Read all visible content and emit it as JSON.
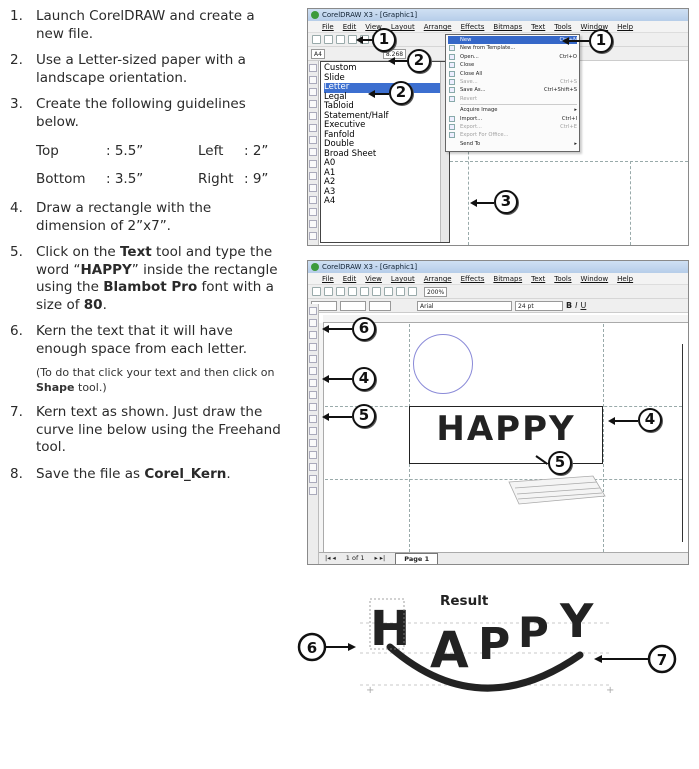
{
  "steps": [
    {
      "num": "1.",
      "text": "Launch CorelDRAW and create a new file."
    },
    {
      "num": "2.",
      "text": "Use a Letter-sized paper with a landscape orientation."
    },
    {
      "num": "3.",
      "text": "Create the following guidelines below."
    },
    {
      "num": "4.",
      "text": "Draw a rectangle with the dimension of 2”x7”."
    },
    {
      "num": "5.",
      "pre": "Click on the ",
      "b1": "Text",
      "mid1": " tool and type the word “",
      "b2": "HAPPY",
      "mid2": "” inside the rectangle using the ",
      "b3": "Blambot Pro",
      "mid3": " font with a size of ",
      "b4": "80",
      "post": "."
    },
    {
      "num": "6.",
      "text": "Kern the text that it will have enough space from each letter."
    },
    {
      "num": "7.",
      "text": "Kern text as shown. Just draw the curve line below using the Freehand tool."
    },
    {
      "num": "8.",
      "pre": "Save the file as ",
      "b1": "Corel_Kern",
      "post": "."
    }
  ],
  "note": {
    "pre": "(To do that click your text and then click on ",
    "bold": "Shape",
    "post": " tool.)"
  },
  "guidelines": [
    {
      "a": "Top",
      "av": ": 5.5”",
      "b": "Left",
      "bv": ": 2”"
    },
    {
      "a": "Bottom",
      "av": ": 3.5”",
      "b": "Right",
      "bv": ": 9”"
    }
  ],
  "shot1": {
    "title": "CorelDRAW X3 - [Graphic1]",
    "menus": [
      "File",
      "Edit",
      "View",
      "Layout",
      "Arrange",
      "Effects",
      "Bitmaps",
      "Text",
      "Tools",
      "Window",
      "Help"
    ],
    "paper_field": "A4",
    "size_field": "8.268",
    "paper_options": [
      "Custom",
      "Slide",
      "Letter",
      "Legal",
      "Tabloid",
      "Statement/Half",
      "Executive",
      "Fanfold",
      "Double",
      "Broad Sheet",
      "A0",
      "A1",
      "A2",
      "A3",
      "A4"
    ],
    "paper_selected": "Letter",
    "file_menu": [
      {
        "label": "New",
        "shortcut": "Ctrl+N",
        "state": "hl"
      },
      {
        "label": "New from Template...",
        "shortcut": "",
        "state": ""
      },
      {
        "label": "Open...",
        "shortcut": "Ctrl+O",
        "state": ""
      },
      {
        "label": "Close",
        "shortcut": "",
        "state": ""
      },
      {
        "label": "Close All",
        "shortcut": "",
        "state": ""
      },
      {
        "label": "Save...",
        "shortcut": "Ctrl+S",
        "state": "dim"
      },
      {
        "label": "Save As...",
        "shortcut": "Ctrl+Shift+S",
        "state": ""
      },
      {
        "label": "Revert",
        "shortcut": "",
        "state": "dim"
      },
      {
        "label": "Acquire Image",
        "shortcut": "",
        "state": ""
      },
      {
        "label": "Import...",
        "shortcut": "Ctrl+I",
        "state": ""
      },
      {
        "label": "Export...",
        "shortcut": "Ctrl+E",
        "state": "dim"
      },
      {
        "label": "Export For Office...",
        "shortcut": "",
        "state": "dim"
      },
      {
        "label": "Send To",
        "shortcut": "",
        "state": ""
      }
    ]
  },
  "shot2": {
    "title": "CorelDRAW X3 - [Graphic1]",
    "menus": [
      "File",
      "Edit",
      "View",
      "Layout",
      "Arrange",
      "Effects",
      "Bitmaps",
      "Text",
      "Tools",
      "Window",
      "Help"
    ],
    "zoom": "200%",
    "font": "Arial",
    "font_size": "24 pt",
    "word": "HAPPY",
    "page_counter": "1 of 1",
    "page_tab": "Page 1"
  },
  "callouts": [
    "1",
    "1",
    "2",
    "2",
    "3",
    "6",
    "4",
    "5",
    "4",
    "5",
    "6",
    "7"
  ],
  "result": {
    "title": "Result",
    "word": "HAPPY"
  },
  "colors": {
    "menu_highlight": "#3567c8",
    "circle": "#8a8ad8",
    "guideline": "#9aa0a8"
  }
}
